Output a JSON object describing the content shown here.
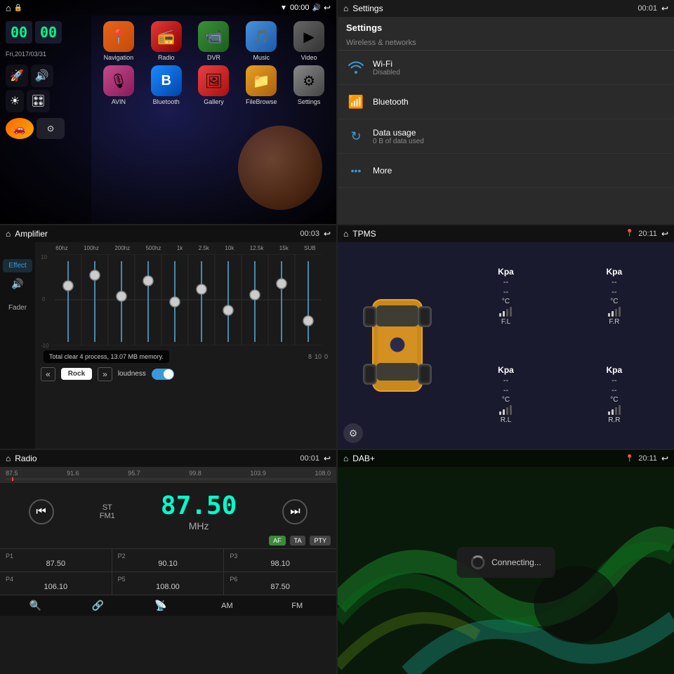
{
  "panels": {
    "home": {
      "title": "Home",
      "clock": {
        "hours": "00",
        "minutes": "00",
        "date": "Fri,2017/03/31"
      },
      "status_bar": {
        "time": "00:00",
        "home_icon": "⌂"
      },
      "apps": [
        {
          "name": "Navigation",
          "icon": "📍",
          "bg": "nav-bg"
        },
        {
          "name": "Radio",
          "icon": "📻",
          "bg": "radio-bg"
        },
        {
          "name": "DVR",
          "icon": "📹",
          "bg": "dvr-bg"
        },
        {
          "name": "Music",
          "icon": "🎵",
          "bg": "music-bg"
        },
        {
          "name": "Video",
          "icon": "▶",
          "bg": "video-bg"
        },
        {
          "name": "AVIN",
          "icon": "🎙",
          "bg": "avin-bg"
        },
        {
          "name": "Bluetooth",
          "icon": "⚙",
          "bg": "bt-bg"
        },
        {
          "name": "Gallery",
          "icon": "🖼",
          "bg": "gallery-bg"
        },
        {
          "name": "FileBrowse",
          "icon": "📁",
          "bg": "filebrowse-bg"
        },
        {
          "name": "Settings",
          "icon": "⚙",
          "bg": "settings-bg"
        }
      ]
    },
    "settings": {
      "title": "Settings",
      "status_bar": {
        "time": "00:01"
      },
      "section": "Settings",
      "group": "Wireless & networks",
      "items": [
        {
          "icon": "wifi",
          "name": "Wi-Fi",
          "sub": "Disabled"
        },
        {
          "icon": "bt",
          "name": "Bluetooth",
          "sub": ""
        },
        {
          "icon": "data",
          "name": "Data usage",
          "sub": "0 B of data used"
        },
        {
          "icon": "more",
          "name": "More",
          "sub": ""
        }
      ]
    },
    "amplifier": {
      "title": "Amplifier",
      "status_bar": {
        "time": "00:03"
      },
      "eq_labels": [
        "60hz",
        "100hz",
        "200hz",
        "500hz",
        "1k",
        "2.5k",
        "10k",
        "12.5k",
        "15k",
        "SUB"
      ],
      "eq_values": [
        50,
        65,
        45,
        70,
        55,
        65,
        50,
        55,
        60,
        40
      ],
      "scale": [
        "10",
        "0",
        "-10"
      ],
      "toast": "Total clear 4 process, 13.07 MB memory.",
      "prev_btn": "«",
      "next_btn": "»",
      "preset": "Rock",
      "loudness": "loudness",
      "effect_label": "Effect",
      "fader_label": "Fader"
    },
    "tpms": {
      "title": "TPMS",
      "status_bar": {
        "time": "20:11"
      },
      "wheels": {
        "fl": {
          "kpa": "--",
          "temp": "--",
          "label": "F.L"
        },
        "fr": {
          "kpa": "--",
          "temp": "--",
          "label": "F.R"
        },
        "rl": {
          "kpa": "--",
          "temp": "--",
          "label": "R.L"
        },
        "rr": {
          "kpa": "--",
          "temp": "--",
          "label": "R.R"
        }
      },
      "unit_kpa": "Kpa",
      "unit_temp": "°C"
    },
    "radio": {
      "title": "Radio",
      "status_bar": {
        "time": "00:01"
      },
      "freq_scale": [
        "87.5",
        "91.6",
        "95.7",
        "99.8",
        "103.9",
        "108.0"
      ],
      "current_freq": "87.50",
      "unit": "MHz",
      "band": "FM1",
      "stereo": "ST",
      "btns": [
        "AF",
        "TA",
        "PTY"
      ],
      "presets": [
        {
          "label": "P1",
          "freq": "87.50"
        },
        {
          "label": "P2",
          "freq": "90.10"
        },
        {
          "label": "P3",
          "freq": "98.10"
        },
        {
          "label": "P4",
          "freq": "106.10"
        },
        {
          "label": "P5",
          "freq": "108.00"
        },
        {
          "label": "P6",
          "freq": "87.50"
        }
      ],
      "bottom_btns": [
        "search",
        "bluetooth",
        "antenna",
        "AM",
        "FM"
      ]
    },
    "dab": {
      "title": "DAB+",
      "status_bar": {
        "time": "20:11"
      },
      "connecting_text": "Connecting..."
    }
  }
}
